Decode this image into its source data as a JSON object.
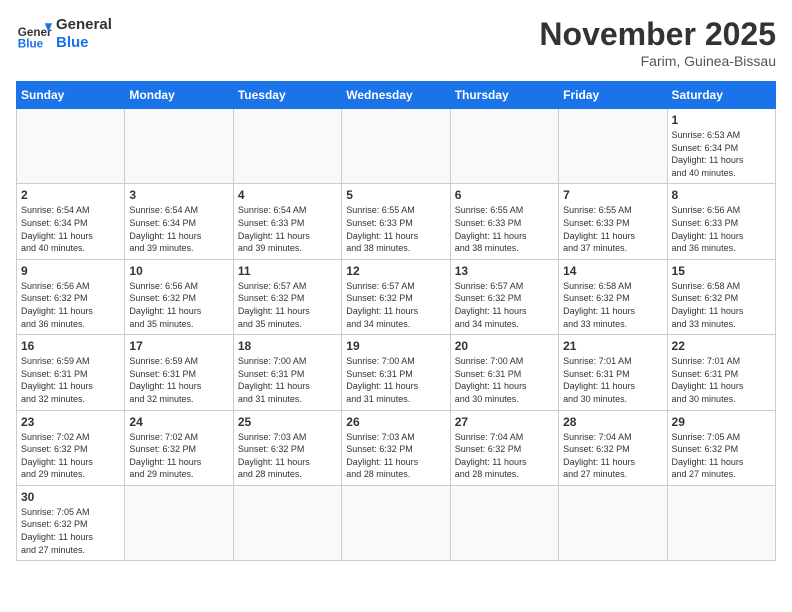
{
  "header": {
    "logo_general": "General",
    "logo_blue": "Blue",
    "month_title": "November 2025",
    "location": "Farim, Guinea-Bissau"
  },
  "days_of_week": [
    "Sunday",
    "Monday",
    "Tuesday",
    "Wednesday",
    "Thursday",
    "Friday",
    "Saturday"
  ],
  "weeks": [
    [
      {
        "day": "",
        "info": ""
      },
      {
        "day": "",
        "info": ""
      },
      {
        "day": "",
        "info": ""
      },
      {
        "day": "",
        "info": ""
      },
      {
        "day": "",
        "info": ""
      },
      {
        "day": "",
        "info": ""
      },
      {
        "day": "1",
        "info": "Sunrise: 6:53 AM\nSunset: 6:34 PM\nDaylight: 11 hours\nand 40 minutes."
      }
    ],
    [
      {
        "day": "2",
        "info": "Sunrise: 6:54 AM\nSunset: 6:34 PM\nDaylight: 11 hours\nand 40 minutes."
      },
      {
        "day": "3",
        "info": "Sunrise: 6:54 AM\nSunset: 6:34 PM\nDaylight: 11 hours\nand 39 minutes."
      },
      {
        "day": "4",
        "info": "Sunrise: 6:54 AM\nSunset: 6:33 PM\nDaylight: 11 hours\nand 39 minutes."
      },
      {
        "day": "5",
        "info": "Sunrise: 6:55 AM\nSunset: 6:33 PM\nDaylight: 11 hours\nand 38 minutes."
      },
      {
        "day": "6",
        "info": "Sunrise: 6:55 AM\nSunset: 6:33 PM\nDaylight: 11 hours\nand 38 minutes."
      },
      {
        "day": "7",
        "info": "Sunrise: 6:55 AM\nSunset: 6:33 PM\nDaylight: 11 hours\nand 37 minutes."
      },
      {
        "day": "8",
        "info": "Sunrise: 6:56 AM\nSunset: 6:33 PM\nDaylight: 11 hours\nand 36 minutes."
      }
    ],
    [
      {
        "day": "9",
        "info": "Sunrise: 6:56 AM\nSunset: 6:32 PM\nDaylight: 11 hours\nand 36 minutes."
      },
      {
        "day": "10",
        "info": "Sunrise: 6:56 AM\nSunset: 6:32 PM\nDaylight: 11 hours\nand 35 minutes."
      },
      {
        "day": "11",
        "info": "Sunrise: 6:57 AM\nSunset: 6:32 PM\nDaylight: 11 hours\nand 35 minutes."
      },
      {
        "day": "12",
        "info": "Sunrise: 6:57 AM\nSunset: 6:32 PM\nDaylight: 11 hours\nand 34 minutes."
      },
      {
        "day": "13",
        "info": "Sunrise: 6:57 AM\nSunset: 6:32 PM\nDaylight: 11 hours\nand 34 minutes."
      },
      {
        "day": "14",
        "info": "Sunrise: 6:58 AM\nSunset: 6:32 PM\nDaylight: 11 hours\nand 33 minutes."
      },
      {
        "day": "15",
        "info": "Sunrise: 6:58 AM\nSunset: 6:32 PM\nDaylight: 11 hours\nand 33 minutes."
      }
    ],
    [
      {
        "day": "16",
        "info": "Sunrise: 6:59 AM\nSunset: 6:31 PM\nDaylight: 11 hours\nand 32 minutes."
      },
      {
        "day": "17",
        "info": "Sunrise: 6:59 AM\nSunset: 6:31 PM\nDaylight: 11 hours\nand 32 minutes."
      },
      {
        "day": "18",
        "info": "Sunrise: 7:00 AM\nSunset: 6:31 PM\nDaylight: 11 hours\nand 31 minutes."
      },
      {
        "day": "19",
        "info": "Sunrise: 7:00 AM\nSunset: 6:31 PM\nDaylight: 11 hours\nand 31 minutes."
      },
      {
        "day": "20",
        "info": "Sunrise: 7:00 AM\nSunset: 6:31 PM\nDaylight: 11 hours\nand 30 minutes."
      },
      {
        "day": "21",
        "info": "Sunrise: 7:01 AM\nSunset: 6:31 PM\nDaylight: 11 hours\nand 30 minutes."
      },
      {
        "day": "22",
        "info": "Sunrise: 7:01 AM\nSunset: 6:31 PM\nDaylight: 11 hours\nand 30 minutes."
      }
    ],
    [
      {
        "day": "23",
        "info": "Sunrise: 7:02 AM\nSunset: 6:32 PM\nDaylight: 11 hours\nand 29 minutes."
      },
      {
        "day": "24",
        "info": "Sunrise: 7:02 AM\nSunset: 6:32 PM\nDaylight: 11 hours\nand 29 minutes."
      },
      {
        "day": "25",
        "info": "Sunrise: 7:03 AM\nSunset: 6:32 PM\nDaylight: 11 hours\nand 28 minutes."
      },
      {
        "day": "26",
        "info": "Sunrise: 7:03 AM\nSunset: 6:32 PM\nDaylight: 11 hours\nand 28 minutes."
      },
      {
        "day": "27",
        "info": "Sunrise: 7:04 AM\nSunset: 6:32 PM\nDaylight: 11 hours\nand 28 minutes."
      },
      {
        "day": "28",
        "info": "Sunrise: 7:04 AM\nSunset: 6:32 PM\nDaylight: 11 hours\nand 27 minutes."
      },
      {
        "day": "29",
        "info": "Sunrise: 7:05 AM\nSunset: 6:32 PM\nDaylight: 11 hours\nand 27 minutes."
      }
    ],
    [
      {
        "day": "30",
        "info": "Sunrise: 7:05 AM\nSunset: 6:32 PM\nDaylight: 11 hours\nand 27 minutes."
      },
      {
        "day": "",
        "info": ""
      },
      {
        "day": "",
        "info": ""
      },
      {
        "day": "",
        "info": ""
      },
      {
        "day": "",
        "info": ""
      },
      {
        "day": "",
        "info": ""
      },
      {
        "day": "",
        "info": ""
      }
    ]
  ]
}
